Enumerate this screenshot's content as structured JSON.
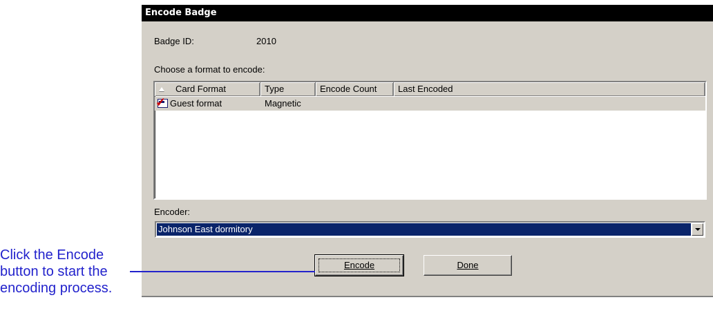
{
  "dialog": {
    "title": "Encode Badge",
    "badge_id_label": "Badge ID:",
    "badge_id_value": "2010",
    "format_prompt": "Choose a format to encode:",
    "columns": [
      "Card Format",
      "Type",
      "Encode Count",
      "Last Encoded"
    ],
    "rows": [
      {
        "icon": "card-checked-icon",
        "card_format": "Guest format",
        "type": "Magnetic",
        "encode_count": "",
        "last_encoded": ""
      }
    ],
    "encoder_label": "Encoder:",
    "encoder_value": "Johnson East dormitory",
    "encode_button": "Encode",
    "done_button": "Done"
  },
  "callout": {
    "text": "Click the Encode button to start the encoding process."
  },
  "colors": {
    "callout": "#2222cc",
    "selection": "#0a246a",
    "dialog_face": "#d4d0c8",
    "title_bar": "#000000"
  }
}
